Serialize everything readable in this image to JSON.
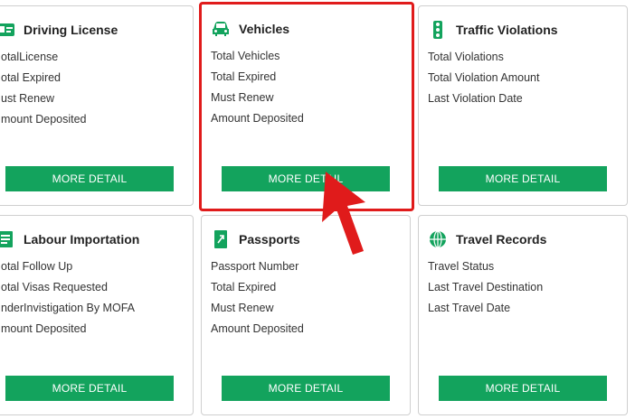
{
  "cards": [
    {
      "title": "Driving License",
      "rows": [
        "otalLicense",
        "otal Expired",
        "ust Renew",
        "mount Deposited"
      ],
      "button": "MORE DETAIL"
    },
    {
      "title": "Vehicles",
      "rows": [
        "Total Vehicles",
        "Total Expired",
        "Must Renew",
        "Amount Deposited"
      ],
      "button": "MORE DETAIL"
    },
    {
      "title": "Traffic Violations",
      "rows": [
        "Total Violations",
        "Total Violation Amount",
        "Last Violation Date"
      ],
      "button": "MORE DETAIL"
    },
    {
      "title": "Labour Importation",
      "rows": [
        "otal Follow Up",
        "otal Visas Requested",
        "nderInvistigation By MOFA",
        "mount Deposited"
      ],
      "button": "MORE DETAIL"
    },
    {
      "title": "Passports",
      "rows": [
        "Passport Number",
        "Total Expired",
        "Must Renew",
        "Amount Deposited"
      ],
      "button": "MORE DETAIL"
    },
    {
      "title": "Travel Records",
      "rows": [
        "Travel Status",
        "Last Travel Destination",
        "Last Travel Date"
      ],
      "button": "MORE DETAIL"
    }
  ],
  "icons": {
    "driving_license": "id-card-icon",
    "vehicles": "car-icon",
    "traffic_violations": "traffic-light-icon",
    "labour_importation": "document-icon",
    "passports": "passport-icon",
    "travel_records": "globe-icon"
  },
  "colors": {
    "accent": "#13a35d",
    "highlight": "#e01b1b",
    "border": "#cfcfcf"
  }
}
